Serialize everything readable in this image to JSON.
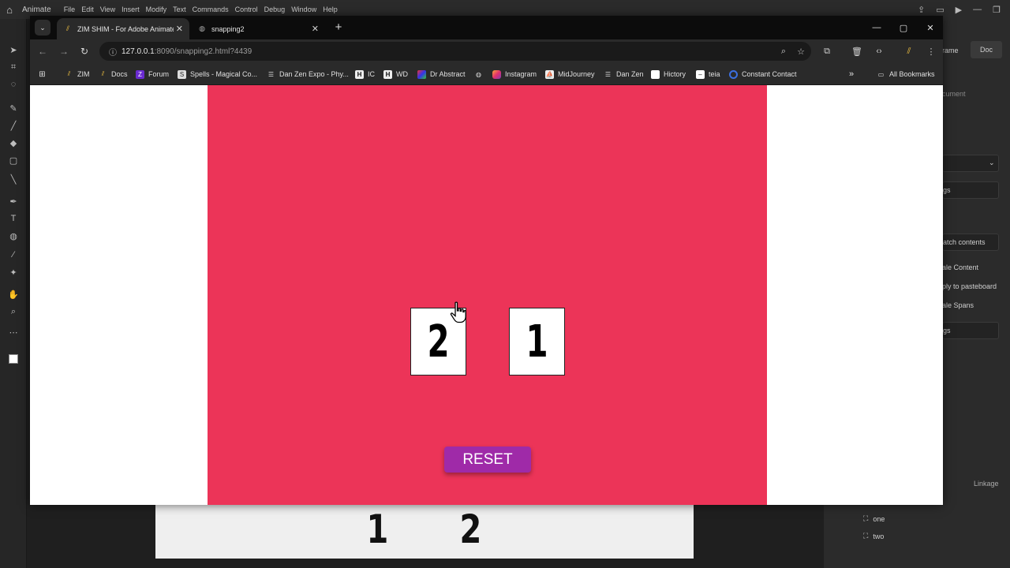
{
  "app": {
    "name": "Animate",
    "menu": [
      "File",
      "Edit",
      "View",
      "Insert",
      "Modify",
      "Text",
      "Commands",
      "Control",
      "Debug",
      "Window",
      "Help"
    ]
  },
  "right_panel": {
    "tab_frame": "rame",
    "tab_doc": "Doc",
    "document": "cument",
    "settings1": "gs",
    "match_contents": "atch contents",
    "scale_content": "ale Content",
    "apply_pasteboard": "ply to pasteboard",
    "scale_spans": "ale Spans",
    "settings2": "gs",
    "linkage": "Linkage",
    "library_items": [
      "one",
      "two"
    ]
  },
  "stage": {
    "numbers": [
      "1",
      "2"
    ]
  },
  "browser": {
    "tabs": [
      {
        "title": "ZIM SHIM - For Adobe Animate",
        "active": true
      },
      {
        "title": "snapping2",
        "active": false
      }
    ],
    "url_host": "127.0.0.1",
    "url_path": ":8090/snapping2.html?4439",
    "bookmarks": [
      {
        "label": "ZIM",
        "icon": "zim-icon"
      },
      {
        "label": "Docs",
        "icon": "zim-icon"
      },
      {
        "label": "Forum",
        "icon": "z-icon"
      },
      {
        "label": "Spells - Magical Co...",
        "icon": "spells-icon"
      },
      {
        "label": "Dan Zen Expo - Phy...",
        "icon": "doc-icon"
      },
      {
        "label": "IC",
        "icon": "h-icon"
      },
      {
        "label": "WD",
        "icon": "h-icon"
      },
      {
        "label": "Dr Abstract",
        "icon": "drabstract-icon"
      },
      {
        "label": "",
        "icon": "globe-icon"
      },
      {
        "label": "Instagram",
        "icon": "instagram-icon"
      },
      {
        "label": "MidJourney",
        "icon": "midjourney-icon"
      },
      {
        "label": "Dan Zen",
        "icon": "doc-icon"
      },
      {
        "label": "Hictory",
        "icon": "blank-icon"
      },
      {
        "label": "teia",
        "icon": "teia-icon"
      },
      {
        "label": "Constant Contact",
        "icon": "constant-contact-icon"
      }
    ],
    "all_bookmarks": "All Bookmarks"
  },
  "page": {
    "cards": [
      "2",
      "1"
    ],
    "reset_label": "RESET"
  },
  "colors": {
    "canvas": "#ec3458",
    "reset_button": "#9f2aa8"
  }
}
